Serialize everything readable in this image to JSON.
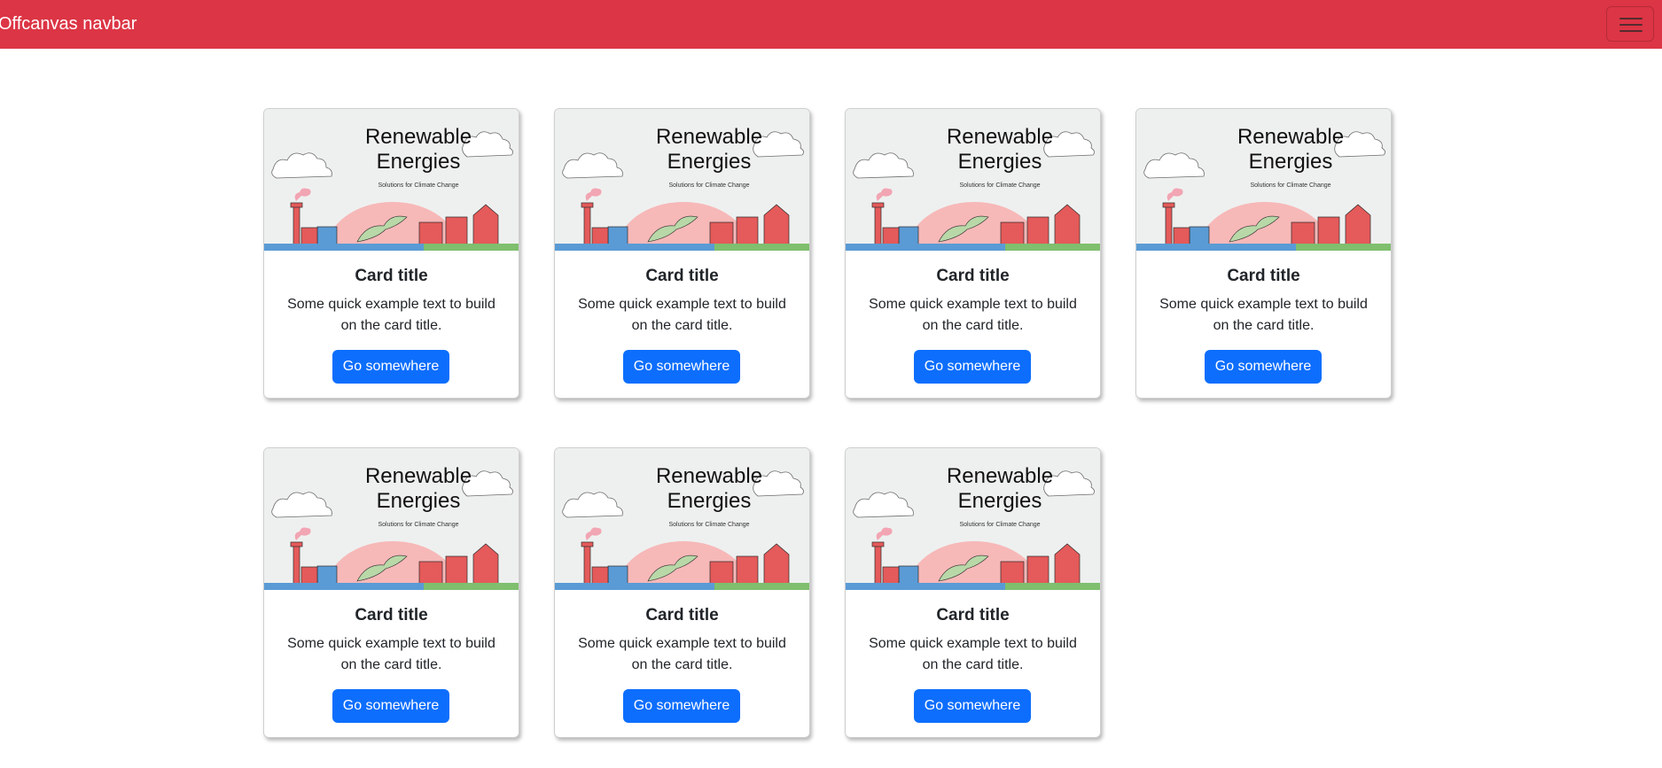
{
  "navbar": {
    "brand": "Offcanvas navbar",
    "toggler_icon": "hamburger-menu-icon",
    "background_color": "#dc3545"
  },
  "image_text": {
    "line1": "Renewable",
    "line2": "Energies",
    "line3": "Solutions for Climate Change"
  },
  "cards": [
    {
      "title": "Card title",
      "text": "Some quick example text to build on the card title.",
      "button": "Go somewhere"
    },
    {
      "title": "Card title",
      "text": "Some quick example text to build on the card title.",
      "button": "Go somewhere"
    },
    {
      "title": "Card title",
      "text": "Some quick example text to build on the card title.",
      "button": "Go somewhere"
    },
    {
      "title": "Card title",
      "text": "Some quick example text to build on the card title.",
      "button": "Go somewhere"
    },
    {
      "title": "Card title",
      "text": "Some quick example text to build on the card title.",
      "button": "Go somewhere"
    },
    {
      "title": "Card title",
      "text": "Some quick example text to build on the card title.",
      "button": "Go somewhere"
    },
    {
      "title": "Card title",
      "text": "Some quick example text to build on the card title.",
      "button": "Go somewhere"
    }
  ],
  "colors": {
    "primary_button": "#0d6efd",
    "illustration_background": "#eef0ef"
  }
}
